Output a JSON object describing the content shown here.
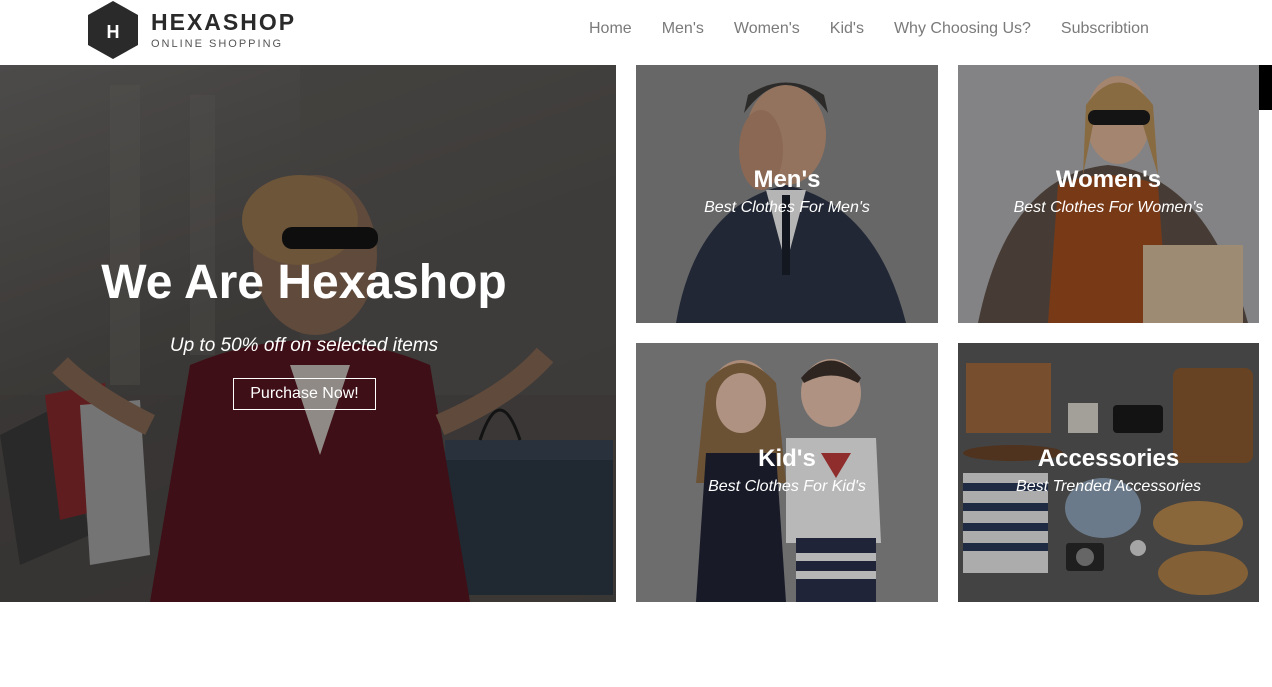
{
  "brand": {
    "logo_letter": "H",
    "name": "HEXASHOP",
    "tagline": "ONLINE SHOPPING"
  },
  "nav": {
    "items": [
      {
        "label": "Home"
      },
      {
        "label": "Men's"
      },
      {
        "label": "Women's"
      },
      {
        "label": "Kid's"
      },
      {
        "label": "Why Choosing Us?"
      },
      {
        "label": "Subscribtion"
      }
    ]
  },
  "hero": {
    "title": "We Are Hexashop",
    "subtitle": "Up to 50% off on selected items",
    "button_label": "Purchase Now!"
  },
  "categories": {
    "men": {
      "title": "Men's",
      "subtitle": "Best Clothes For Men's"
    },
    "women": {
      "title": "Women's",
      "subtitle": "Best Clothes For Women's"
    },
    "kids": {
      "title": "Kid's",
      "subtitle": "Best Clothes For Kid's"
    },
    "accessories": {
      "title": "Accessories",
      "subtitle": "Best Trended Accessories"
    }
  },
  "colors": {
    "logo_dark": "#2a2a2a",
    "nav_text": "#7a7a7a",
    "overlay_text": "#ffffff"
  }
}
